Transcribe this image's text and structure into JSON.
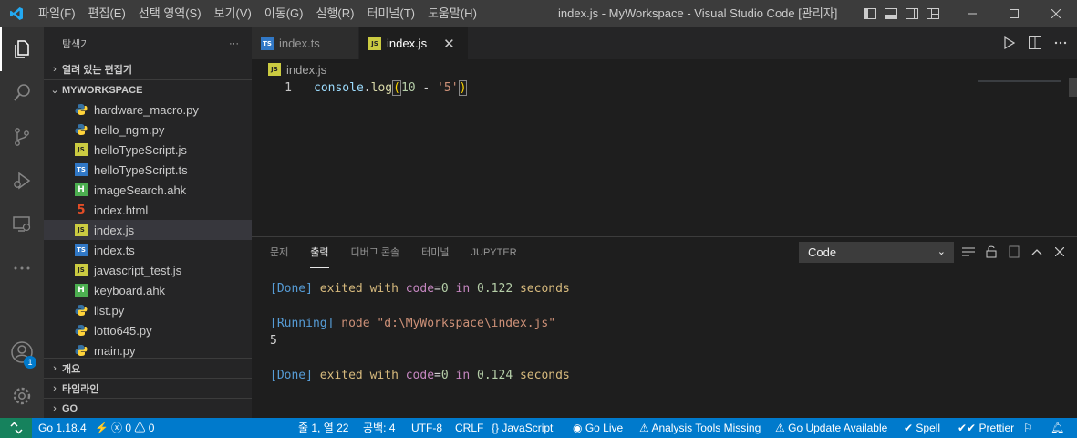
{
  "titlebar": {
    "menu": [
      "파일(F)",
      "편집(E)",
      "선택 영역(S)",
      "보기(V)",
      "이동(G)",
      "실행(R)",
      "터미널(T)",
      "도움말(H)"
    ],
    "title": "index.js - MyWorkspace - Visual Studio Code [관리자]"
  },
  "activity": {
    "badge": "1"
  },
  "sidebar": {
    "header": "탐색기",
    "more": "···",
    "open_editors": "열려 있는 편집기",
    "workspace": "MYWORKSPACE",
    "files": [
      {
        "name": "hardware_macro.py",
        "type": "py"
      },
      {
        "name": "hello_ngm.py",
        "type": "py"
      },
      {
        "name": "helloTypeScript.js",
        "type": "js"
      },
      {
        "name": "helloTypeScript.ts",
        "type": "ts"
      },
      {
        "name": "imageSearch.ahk",
        "type": "ahk"
      },
      {
        "name": "index.html",
        "type": "html"
      },
      {
        "name": "index.js",
        "type": "js"
      },
      {
        "name": "index.ts",
        "type": "ts"
      },
      {
        "name": "javascript_test.js",
        "type": "js"
      },
      {
        "name": "keyboard.ahk",
        "type": "ahk"
      },
      {
        "name": "list.py",
        "type": "py"
      },
      {
        "name": "lotto645.py",
        "type": "py"
      },
      {
        "name": "main.py",
        "type": "py"
      }
    ],
    "outline": "개요",
    "timeline": "타임라인",
    "go": "GO"
  },
  "tabs": [
    {
      "label": "index.ts",
      "icon": "TS"
    },
    {
      "label": "index.js",
      "icon": "JS"
    }
  ],
  "breadcrumb": "index.js",
  "editor": {
    "line_number": "1",
    "tokens": [
      "console",
      ".",
      "log",
      "(",
      "10",
      " - ",
      "'5'",
      ")"
    ]
  },
  "panel": {
    "tabs": [
      "문제",
      "출력",
      "디버그 콘솔",
      "터미널",
      "JUPYTER"
    ],
    "output_channel": "Code",
    "output": {
      "done1": {
        "tag": "[Done]",
        "a": " exited ",
        "with": "with",
        "b": " code",
        "eq": "=",
        "zero": "0",
        "in": " in ",
        "time": "0.122",
        "unit": " seconds"
      },
      "running": {
        "tag": "[Running]",
        "cmd": " node \"d:\\MyWorkspace\\index.js\""
      },
      "result": "5",
      "done2": {
        "tag": "[Done]",
        "a": " exited ",
        "with": "with",
        "b": " code",
        "eq": "=",
        "zero": "0",
        "in": " in ",
        "time": "0.124",
        "unit": " seconds"
      }
    }
  },
  "statusbar": {
    "go_version": "Go 1.18.4",
    "errors": "0",
    "warnings": "0",
    "position": "줄 1, 열 22",
    "spaces": "공백: 4",
    "encoding": "UTF-8",
    "eol": "CRLF",
    "language": "JavaScript",
    "go_live": "Go Live",
    "analysis": "Analysis Tools Missing",
    "go_update": "Go Update Available",
    "spell": "Spell",
    "prettier": "Prettier"
  },
  "colors": {
    "accent": "#007acc",
    "remote": "#16825d",
    "activity_bar": "#333333",
    "sidebar": "#252526",
    "editor": "#1e1e1e"
  }
}
